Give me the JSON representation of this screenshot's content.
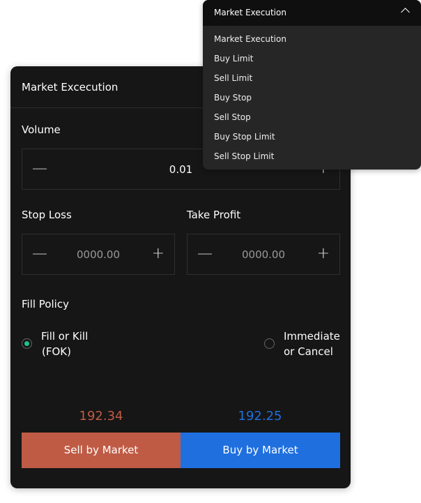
{
  "panel": {
    "title": "Market Excecution",
    "volume_label": "Volume",
    "volume_value": "0.01",
    "stop_loss_label": "Stop Loss",
    "stop_loss_placeholder": "0000.00",
    "take_profit_label": "Take Profit",
    "take_profit_placeholder": "0000.00",
    "fill_policy_label": "Fill Policy",
    "fill_options": [
      {
        "line1": "Fill or Kill",
        "line2": "(FOK)",
        "selected": true
      },
      {
        "line1": "Immediate",
        "line2": "or Cancel",
        "selected": false
      }
    ],
    "sell_price": "192.34",
    "buy_price": "192.25",
    "sell_label": "Sell by Market",
    "buy_label": "Buy by Market"
  },
  "dropdown": {
    "selected": "Market Execution",
    "options": [
      "Market Execution",
      "Buy Limit",
      "Sell Limit",
      "Buy Stop",
      "Sell Stop",
      "Buy Stop Limit",
      "Sell Stop Limit"
    ]
  },
  "colors": {
    "sell": "#bf5b45",
    "buy": "#1f6fdf",
    "radio_selected": "#1fc08f"
  }
}
